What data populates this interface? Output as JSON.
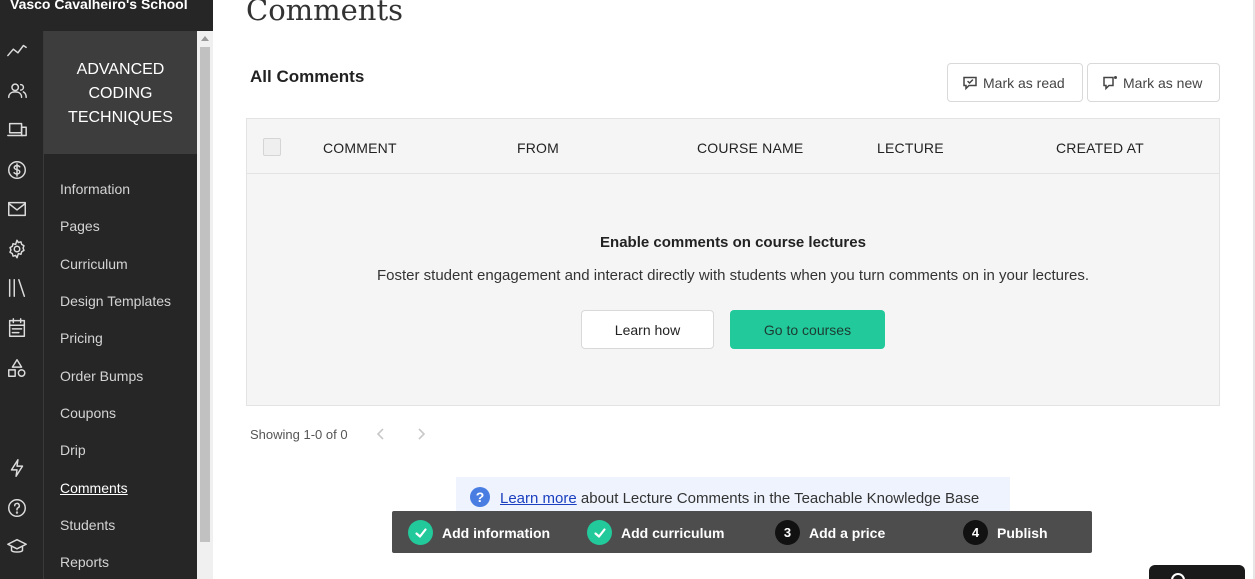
{
  "school": {
    "name": "Vasco Cavalheiro's School"
  },
  "rail": {
    "icons": [
      "analytics-icon",
      "users-icon",
      "devices-icon",
      "dollar-icon",
      "mail-icon",
      "gear-icon",
      "library-icon",
      "calendar-icon",
      "shapes-icon",
      "lightning-icon",
      "help-icon",
      "graduation-cap-icon"
    ]
  },
  "course": {
    "title_line1": "ADVANCED",
    "title_line2": "CODING",
    "title_line3": "TECHNIQUES"
  },
  "nav": {
    "items": [
      {
        "label": "Information"
      },
      {
        "label": "Pages"
      },
      {
        "label": "Curriculum"
      },
      {
        "label": "Design Templates"
      },
      {
        "label": "Pricing"
      },
      {
        "label": "Order Bumps"
      },
      {
        "label": "Coupons"
      },
      {
        "label": "Drip"
      },
      {
        "label": "Comments",
        "active": true
      },
      {
        "label": "Students"
      },
      {
        "label": "Reports"
      }
    ]
  },
  "page": {
    "title": "Comments",
    "section_title": "All Comments",
    "mark_read_label": "Mark as read",
    "mark_new_label": "Mark as new"
  },
  "table": {
    "columns": [
      "COMMENT",
      "FROM",
      "COURSE NAME",
      "LECTURE",
      "CREATED AT"
    ],
    "empty_title": "Enable comments on course lectures",
    "empty_desc": "Foster student engagement and interact directly with students when you turn comments on in your lectures.",
    "learn_label": "Learn how",
    "courses_label": "Go to courses"
  },
  "pagination": {
    "text": "Showing 1-0 of 0"
  },
  "info": {
    "link_text": "Learn more",
    "text": " about Lecture Comments in the Teachable Knowledge Base"
  },
  "progress": {
    "steps": [
      {
        "label": "Add information",
        "status": "done"
      },
      {
        "label": "Add curriculum",
        "status": "done"
      },
      {
        "number": "3",
        "label": "Add a price",
        "status": "todo"
      },
      {
        "number": "4",
        "label": "Publish",
        "status": "todo"
      }
    ]
  },
  "colors": {
    "accent": "#22c99a",
    "sidebar": "#262626",
    "link": "#1a3fbf"
  }
}
